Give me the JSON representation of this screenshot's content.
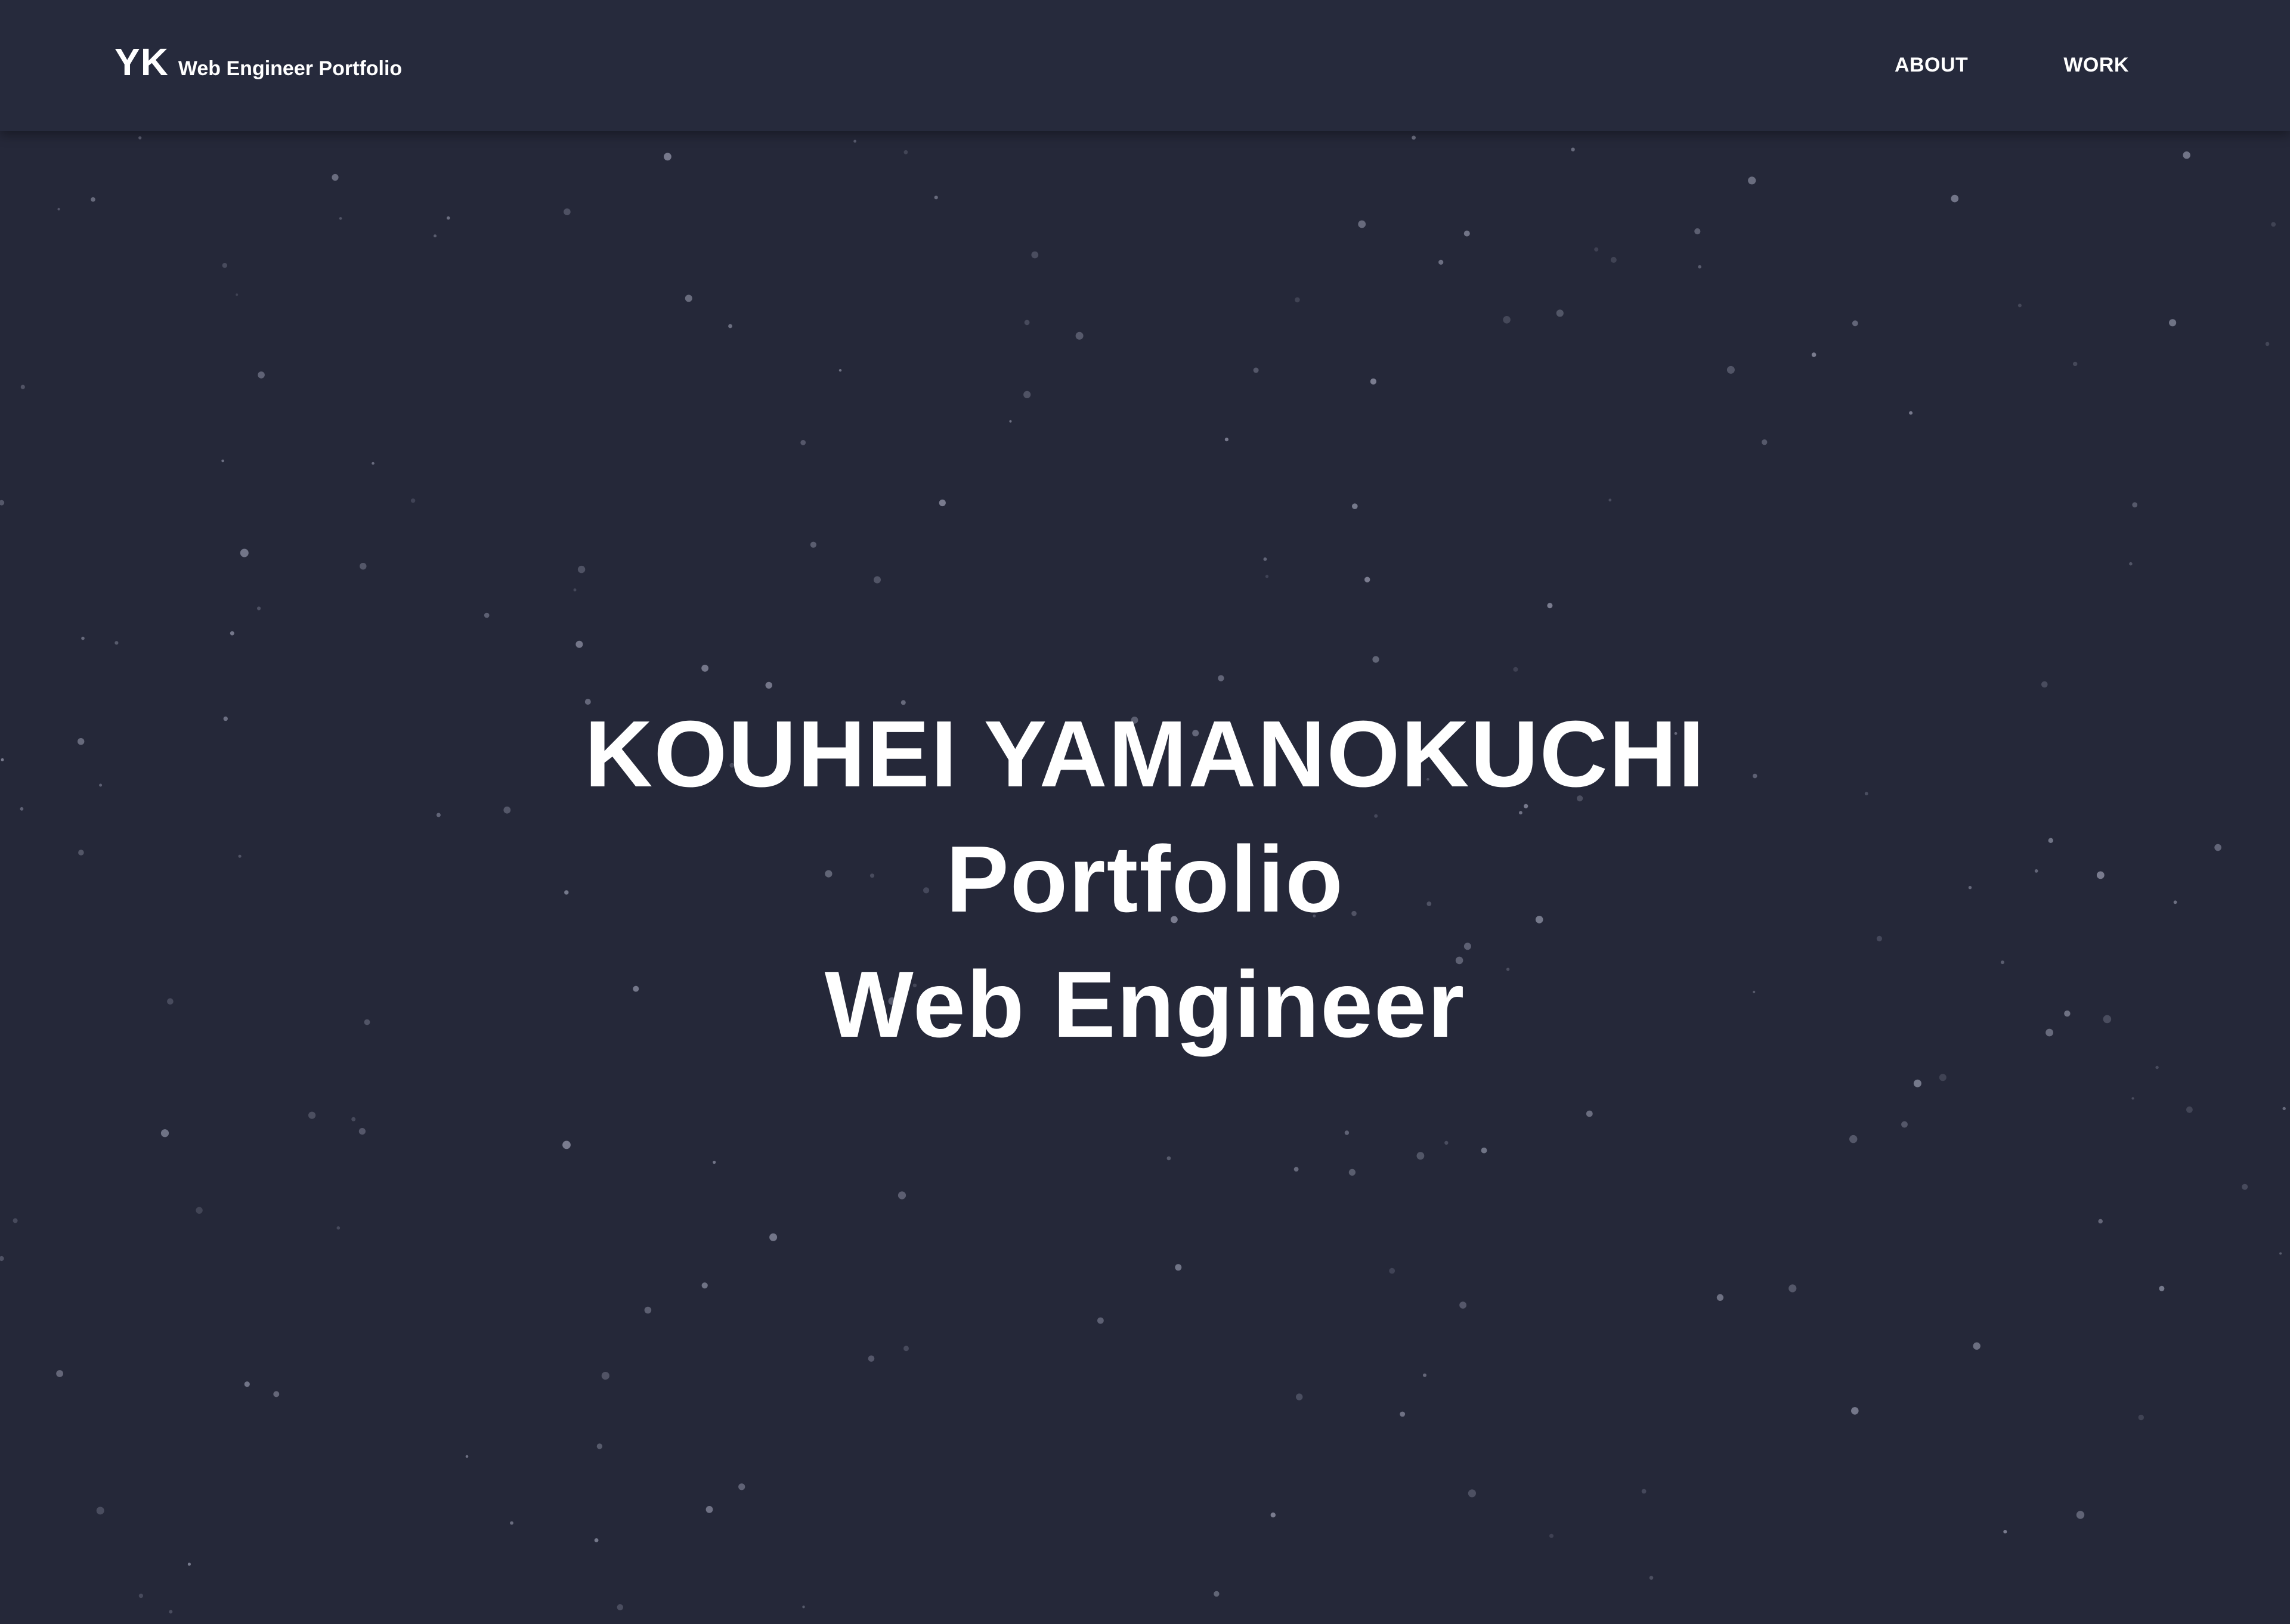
{
  "header": {
    "brand_mark": "YK",
    "brand_subtitle": "Web Engineer Portfolio",
    "nav": [
      {
        "label": "ABOUT"
      },
      {
        "label": "WORK"
      }
    ]
  },
  "hero": {
    "name": "KOUHEI YAMANOKUCHI",
    "line2": "Portfolio",
    "line3": "Web Engineer"
  },
  "colors": {
    "background": "#252839",
    "header_background": "#262a3c",
    "text": "#ffffff",
    "star": "#8a8da0"
  }
}
